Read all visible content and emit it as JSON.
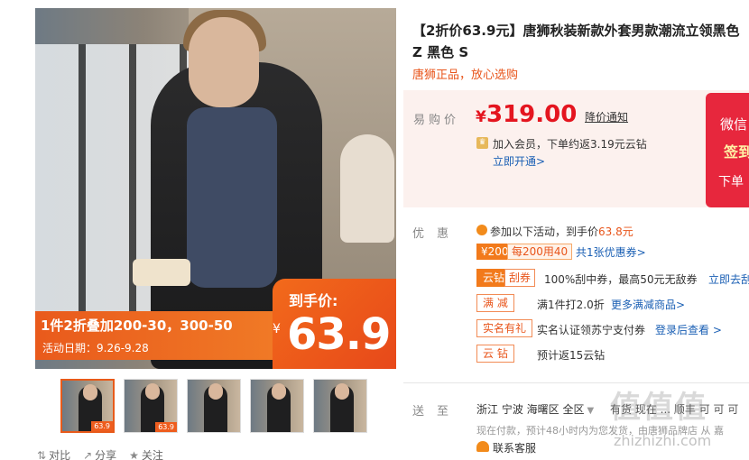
{
  "gallery": {
    "banner_line1": "1件2折叠加200-30，300-50",
    "banner_line2": "活动日期：9.26-9.28",
    "badge_label": "到手价:",
    "badge_currency": "¥",
    "badge_price": "63.9",
    "thumb_badge": "63.9"
  },
  "actions": {
    "compare": "对比",
    "share": "分享",
    "follow": "关注"
  },
  "product": {
    "title_line1": "【2折价63.9元】唐狮秋装新款外套男款潮流立领黑色",
    "title_line2": "Z 黑色 S",
    "subtitle": "唐狮正品，放心选购"
  },
  "price": {
    "label": "易购价",
    "currency": "¥",
    "value": "319.00",
    "notice": "降价通知",
    "vip_text": "加入会员，下单约返3.19元云钻",
    "vip_link": "立即开通>"
  },
  "wechat": {
    "line1": "微信",
    "line2": "签到",
    "line3": "下单"
  },
  "promo": {
    "label": "优惠",
    "head_prefix": "参加以下活动，到手价",
    "head_price": "63.8元",
    "coupon1": "¥200",
    "coupon2": "每200用40",
    "coupon_more": "共1张优惠券>",
    "rows": [
      {
        "tag": "云钻",
        "tag2": "刮券",
        "text": "100%刮中券，最高50元无敌券",
        "link": "立即去刮"
      },
      {
        "tag": "满 减",
        "text": "满1件打2.0折",
        "link": "更多满减商品>"
      },
      {
        "tag": "实名有礼",
        "text": "实名认证领苏宁支付券",
        "link": "登录后查看 >"
      },
      {
        "tag": "云 钻",
        "text": "预计返15云钻"
      }
    ],
    "cloud_count": "15"
  },
  "shipping": {
    "label": "送至",
    "location": "浙江 宁波 海曙区 全区",
    "extra": "有货 现在 ... 顺丰 可 可 可",
    "note": "现在付款，预计48小时内为您发货，由唐狮品牌店 从 嘉",
    "customer_service": "联系客服"
  },
  "watermark": {
    "big": "值值值",
    "small": "zhizhizhi.com"
  }
}
